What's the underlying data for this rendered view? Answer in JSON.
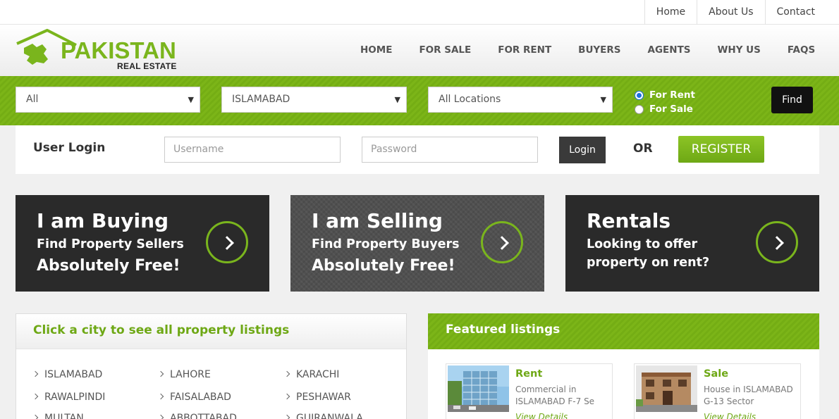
{
  "top_links": [
    "Home",
    "About Us",
    "Contact"
  ],
  "logo": {
    "main": "PAKISTAN",
    "sub": "REAL ESTATE"
  },
  "nav": [
    "HOME",
    "FOR SALE",
    "FOR RENT",
    "BUYERS",
    "AGENTS",
    "WHY US",
    "FAQS"
  ],
  "search": {
    "type_value": "All",
    "city_value": "ISLAMABAD",
    "location_value": "All Locations",
    "radio_rent": "For Rent",
    "radio_sale": "For Sale",
    "find_label": "Find"
  },
  "login": {
    "title": "User Login",
    "username_placeholder": "Username",
    "password_placeholder": "Password",
    "login_label": "Login",
    "or_label": "OR",
    "register_label": "REGISTER"
  },
  "tiles": [
    {
      "title": "I am Buying",
      "line1": "Find Property Sellers",
      "line2": "Absolutely Free!"
    },
    {
      "title": "I am Selling",
      "line1": "Find Property Buyers",
      "line2": "Absolutely Free!"
    },
    {
      "title": "Rentals",
      "line1": "Looking to offer",
      "line2": "property on rent?"
    }
  ],
  "cities": {
    "heading": "Click a city to see all property listings",
    "items": [
      "ISLAMABAD",
      "LAHORE",
      "KARACHI",
      "RAWALPINDI",
      "FAISALABAD",
      "PESHAWAR",
      "MULTAN",
      "ABBOTTABAD",
      "GUJRANWALA"
    ]
  },
  "featured": {
    "heading": "Featured listings",
    "listings": [
      {
        "type": "Rent",
        "desc": "Commercial in ISLAMABAD F-7 Se",
        "link": "View Details"
      },
      {
        "type": "Sale",
        "desc": "House in ISLAMABAD G-13 Sector",
        "link": "View Details"
      }
    ]
  },
  "colors": {
    "brand_green": "#7ab51d",
    "dark": "#2a2a2a"
  }
}
